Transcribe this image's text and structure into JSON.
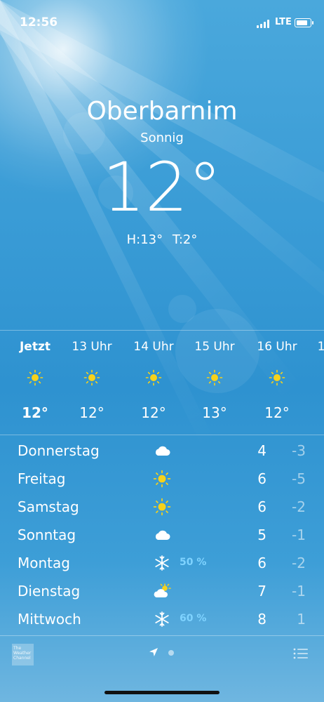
{
  "status": {
    "time": "12:56",
    "network": "LTE"
  },
  "location": {
    "city": "Oberbarnim",
    "condition": "Sonnig",
    "temperature": "12°",
    "high": "H:13°",
    "low": "T:2°"
  },
  "hourly": [
    {
      "label": "Jetzt",
      "icon": "sun-icon",
      "temp": "12°",
      "current": true
    },
    {
      "label": "13 Uhr",
      "icon": "sun-icon",
      "temp": "12°"
    },
    {
      "label": "14 Uhr",
      "icon": "sun-icon",
      "temp": "12°"
    },
    {
      "label": "15 Uhr",
      "icon": "sun-icon",
      "temp": "13°"
    },
    {
      "label": "16 Uhr",
      "icon": "sun-icon",
      "temp": "12°"
    },
    {
      "label": "1",
      "icon": "sun-icon",
      "temp": ""
    }
  ],
  "daily": [
    {
      "day": "Donnerstag",
      "icon": "cloud-icon",
      "precip": "",
      "high": "4",
      "low": "-3"
    },
    {
      "day": "Freitag",
      "icon": "sun-icon",
      "precip": "",
      "high": "6",
      "low": "-5"
    },
    {
      "day": "Samstag",
      "icon": "sun-icon",
      "precip": "",
      "high": "6",
      "low": "-2"
    },
    {
      "day": "Sonntag",
      "icon": "cloud-icon",
      "precip": "",
      "high": "5",
      "low": "-1"
    },
    {
      "day": "Montag",
      "icon": "snowflake-icon",
      "precip": "50 %",
      "high": "6",
      "low": "-2"
    },
    {
      "day": "Dienstag",
      "icon": "partly-cloudy-icon",
      "precip": "",
      "high": "7",
      "low": "-1"
    },
    {
      "day": "Mittwoch",
      "icon": "snowflake-icon",
      "precip": "60 %",
      "high": "8",
      "low": "1"
    }
  ],
  "toolbar": {
    "weather_channel_logo": "The Weather Channel"
  },
  "colors": {
    "sky": "#3a9cd6",
    "sun": "#f7d21a",
    "precip": "#7fd3ff"
  }
}
